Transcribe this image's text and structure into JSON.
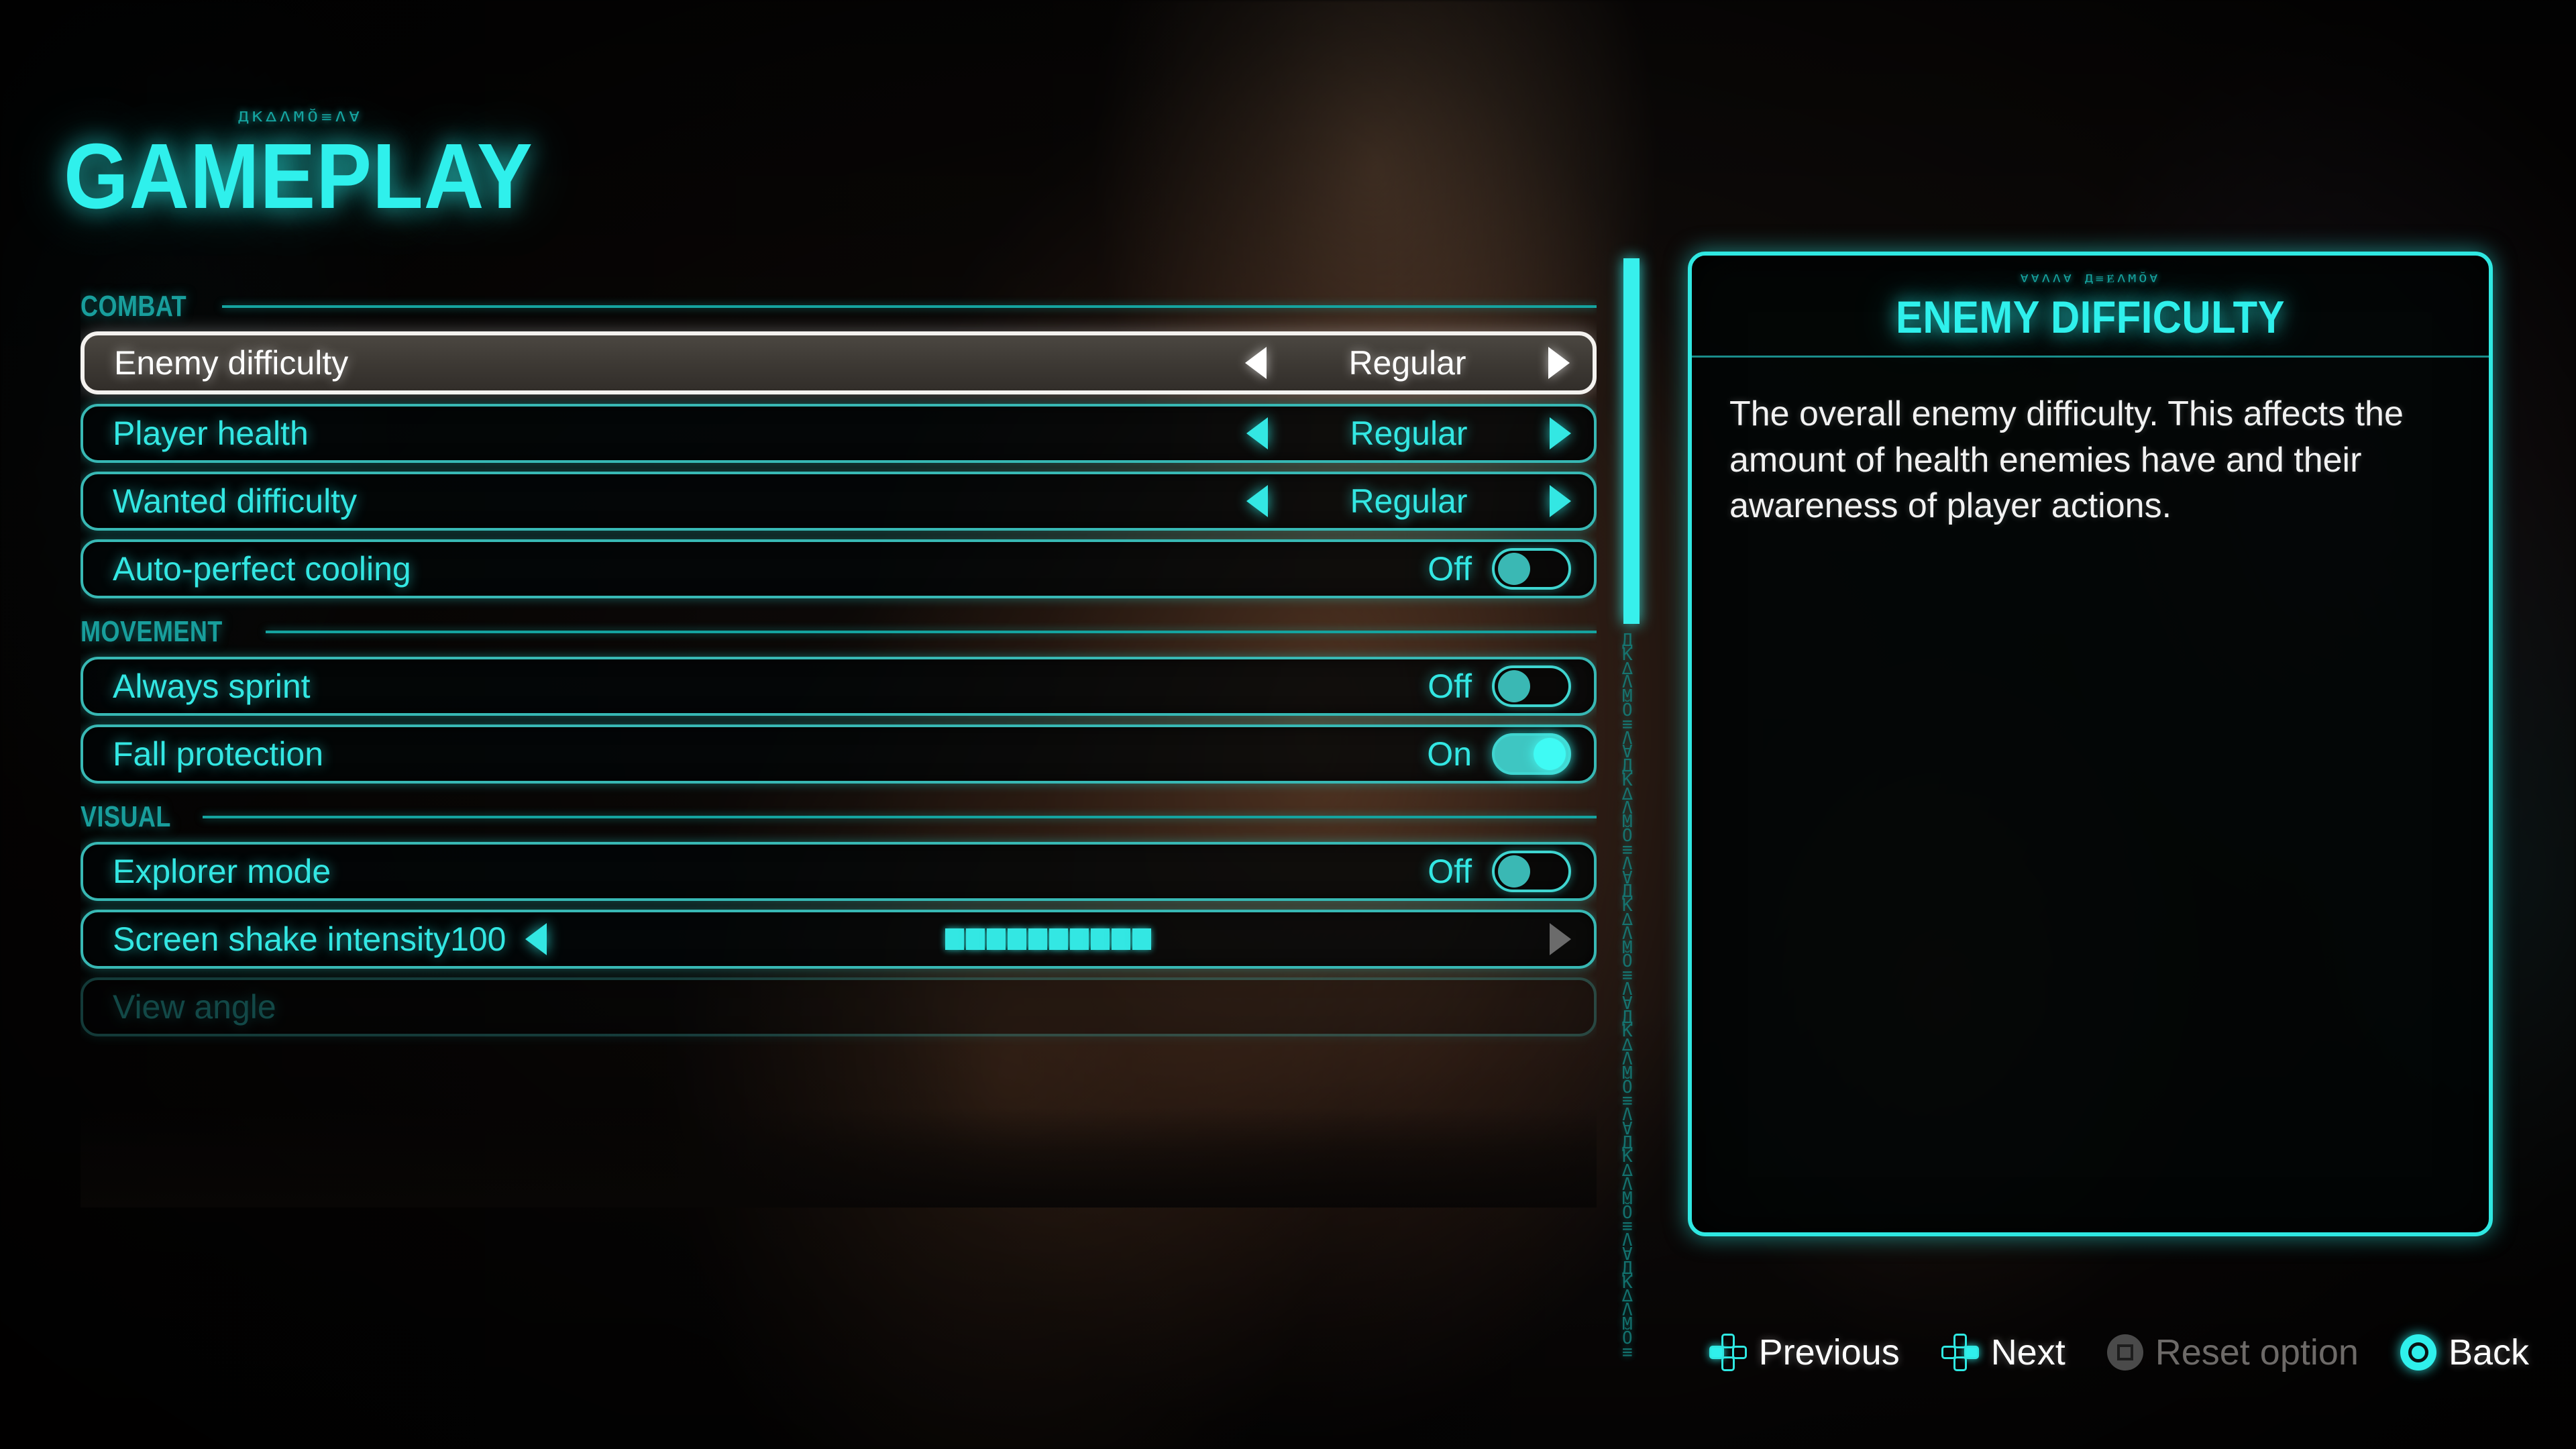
{
  "page": {
    "title": "GAMEPLAY",
    "title_deco": "ДК∆ΛМŎ≡Ʌ∀"
  },
  "sections": [
    {
      "label": "COMBAT",
      "rows": [
        {
          "type": "stepper",
          "label": "Enemy difficulty",
          "value": "Regular",
          "selected": true,
          "left_arrow": true,
          "right_arrow": true
        },
        {
          "type": "stepper",
          "label": "Player health",
          "value": "Regular",
          "selected": false,
          "left_arrow": true,
          "right_arrow": true
        },
        {
          "type": "stepper",
          "label": "Wanted difficulty",
          "value": "Regular",
          "selected": false,
          "left_arrow": true,
          "right_arrow": true
        },
        {
          "type": "toggle",
          "label": "Auto-perfect cooling",
          "state": "Off",
          "on": false
        }
      ]
    },
    {
      "label": "MOVEMENT",
      "rows": [
        {
          "type": "toggle",
          "label": "Always sprint",
          "state": "Off",
          "on": false
        },
        {
          "type": "toggle",
          "label": "Fall protection",
          "state": "On",
          "on": true
        }
      ]
    },
    {
      "label": "VISUAL",
      "rows": [
        {
          "type": "toggle",
          "label": "Explorer mode",
          "state": "Off",
          "on": false
        },
        {
          "type": "slider",
          "label": "Screen shake intensity",
          "value": "100",
          "filled_segments": 10,
          "total_segments": 10,
          "right_arrow_dim": true
        },
        {
          "type": "cutoff",
          "label": "View angle"
        }
      ]
    }
  ],
  "scrollbar": {
    "glyphs": "ДК∆ΛМŎ≡Ʌ∀ДК∆ΛМŎ≡Ʌ∀ДК∆ΛМŎ≡Ʌ∀ДК∆ΛМŎ≡Ʌ∀ДК∆ΛМŎ≡Ʌ∀ДК∆ΛМŎ≡"
  },
  "info_panel": {
    "deco": "∀∀ΛɅ∀ Д≡ɆΛМŎ∀",
    "title": "ENEMY DIFFICULTY",
    "description": "The overall enemy difficulty. This affects the amount of health enemies have and their awareness of player actions."
  },
  "buttons": [
    {
      "label": "Previous",
      "icon": "dpad-left-icon",
      "dimmed": false
    },
    {
      "label": "Next",
      "icon": "dpad-right-icon",
      "dimmed": false
    },
    {
      "label": "Reset option",
      "icon": "square-button-icon",
      "dimmed": true
    },
    {
      "label": "Back",
      "icon": "circle-button-icon",
      "dimmed": false
    }
  ],
  "colors": {
    "accent_cyan": "#2ff0ec",
    "accent_teal": "#38b8b4",
    "section_teal": "#189e9c",
    "selected_border": "#f4f2ef",
    "dim_gray": "#6d6a68"
  }
}
